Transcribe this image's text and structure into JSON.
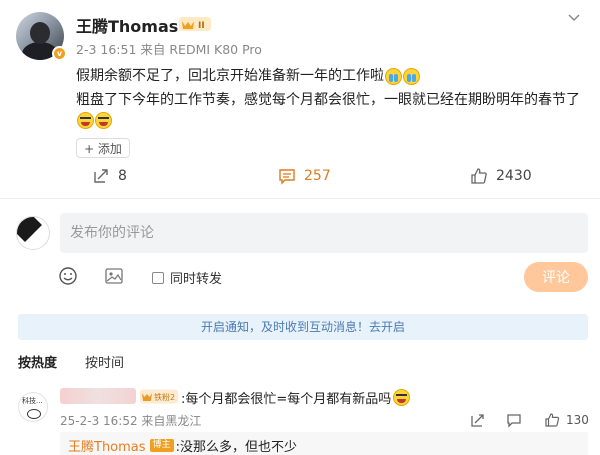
{
  "post": {
    "username": "王腾Thomas",
    "meta": "2-3 16:51 来自 REDMI K80 Pro",
    "lines": [
      "假期余额不足了，回北京开始准备新一年的工作啦",
      "粗盘了下今年的工作节奏，感觉每个月都会很忙，一眼就已经在期盼明年的春节了"
    ],
    "emojis": [
      "cry",
      "cry",
      "cry-laugh",
      "cry-laugh"
    ],
    "add_label": "+ 添加",
    "reposts": "8",
    "comments": "257",
    "likes": "2430",
    "badge_text": "II"
  },
  "composer": {
    "placeholder": "发布你的评论",
    "repost_label": "同时转发",
    "submit_label": "评论"
  },
  "notice": "开启通知，及时收到互动消息！去开启",
  "sort": {
    "hot": "按热度",
    "time": "按时间"
  },
  "comment": {
    "avatar_text": "科技...",
    "level_badge": "铁粉2",
    "text": ":每个月都会很忙=每个月都有新品吗",
    "meta": "25-2-3 16:52 来自黑龙江",
    "likes": "130",
    "reply": {
      "name": "王腾Thomas",
      "badge": "博主",
      "text": ":没那么多，但也不少"
    }
  },
  "colors": {
    "accent": "#e07b1e",
    "submit_disabled": "#ffc79a",
    "notice_bg": "#e8f2fb",
    "notice_text": "#4a7bb3",
    "verified": "#f0a020"
  }
}
